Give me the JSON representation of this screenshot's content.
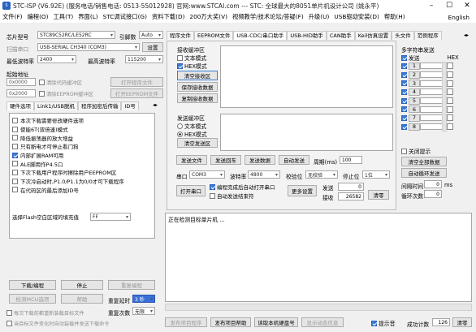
{
  "title": "STC-ISP (V6.92E) (服务电话/销售电话: 0513-55012928) 官网:www.STCAI.com  --- STC: 全球最大的8051单片机设计公司 (姚永平)",
  "menu": [
    "文件(F)",
    "编程(O)",
    "工具(T)",
    "界面(L)",
    "STC调试接口(G)",
    "资料下载(D)",
    "200万大奖(V)",
    "视频教学/技术论坛/答疑(F)",
    "升级(U)",
    "USB驱动安装(D)",
    "帮助(H)",
    "English"
  ],
  "left": {
    "chip_label": "芯片型号",
    "chip_value": "STC89C52RC/LE52RC",
    "engine_label": "引脚数",
    "engine_value": "Auto",
    "scan_label": "扫描串口",
    "port_value": "USB-SERIAL CH340 (COM3)",
    "settings_btn": "设置",
    "min_baud_label": "最低波特率",
    "min_baud": "2400",
    "max_baud_label": "最高波特率",
    "max_baud": "115200",
    "start_addr_label": "起始地址",
    "addr1": "0x0000",
    "clear_code": "清除代码缓冲区",
    "open_prog": "打开程序文件",
    "addr2": "0x2000",
    "clear_eeprom": "清除EEPROM缓冲区",
    "open_eeprom": "打开EEPROM文件",
    "hw_tab": "硬件选项",
    "tabs": [
      "Link1/USB脱机",
      "程序加密后传输",
      "ID号"
    ],
    "options": [
      {
        "label": "本次下载需要修改硬件选项",
        "on": false
      },
      {
        "label": "使能6T(双倍速)模式",
        "on": false
      },
      {
        "label": "降低振荡器的放大增益",
        "on": false
      },
      {
        "label": "只有断电才可停止看门狗",
        "on": false
      },
      {
        "label": "内部扩展RAM可用",
        "on": true
      },
      {
        "label": "ALE脚用作P4.5口",
        "on": false
      },
      {
        "label": "下次下载用户程序时擦除用户EEPROM区",
        "on": false
      },
      {
        "label": "下次冷启动时,P1.0/P1.1为0/0才可下载程序",
        "on": false
      },
      {
        "label": "在代码区的最后添加ID号",
        "on": false
      }
    ],
    "fill_label": "选择Flash空白区域的填充值",
    "fill_value": "FF",
    "download_btn": "下载/编程",
    "stop_btn": "停止",
    "reprogram_btn": "重复编程",
    "check_mcu_btn": "检测MCU选项",
    "help_btn": "帮助",
    "retry_delay_label": "重复延时",
    "retry_delay_value": "3 秒",
    "retry_count_label": "重复次数",
    "retry_count_value": "无限",
    "auto_load": "每次下载前都重新装载目标文件",
    "auto_send": "当目标文件变化时自动装载并发送下载命令"
  },
  "right": {
    "tabs": [
      "程序文件",
      "EEPROM文件",
      "USB-CDC/串口助手",
      "USB-HID助手",
      "CAN助手",
      "Keil仿真设置",
      "头文件",
      "范例程序"
    ],
    "recv_label": "接收缓冲区",
    "text_mode": "文本模式",
    "hex_mode": "HEX模式",
    "clear_recv": "清空接收区",
    "save_recv": "保存接收数据",
    "copy_recv": "复制接收数据",
    "send_label": "发送缓冲区",
    "clear_send": "清空发送区",
    "send_file": "发送文件",
    "send_enter": "发送回车",
    "send_data": "发送数据",
    "auto_send": "自动发送",
    "period_label": "周期(ms)",
    "period_value": "100",
    "port_label": "串口",
    "port_value": "COM3",
    "baud_label": "波特率",
    "baud_value": "4800",
    "parity_label": "校验位",
    "parity_value": "无校验",
    "stop_label": "停止位",
    "stop_value": "1位",
    "open_port": "打开串口",
    "auto_open": "编程完成后自动打开串口",
    "auto_end": "自动发送结束符",
    "more": "更多设置",
    "sent_label": "发送",
    "sent_value": "0",
    "recv_count_label": "接收",
    "recv_count_value": "26582",
    "clear_btn": "清零",
    "multi_label": "多字符串发送",
    "send_col": "发送",
    "hex_col": "HEX",
    "multi_rows": [
      "1",
      "2",
      "3",
      "4",
      "5",
      "6",
      "7",
      "8"
    ],
    "close_tip": "关闭提示",
    "clear_all": "清空全部数据",
    "auto_loop": "自动循环发送",
    "interval_label": "间隔时间",
    "interval_value": "0",
    "interval_unit": "ms",
    "loop_label": "循环次数",
    "loop_value": "0",
    "log_text": "正在检测目标单片机 ..."
  },
  "status": {
    "publish_prog": "发布项目程序",
    "publish_help": "发布项目帮助",
    "read_id": "读取本机硬盘号",
    "show_info": "显示动态信息",
    "tip_sound": "提示音",
    "success_label": "成功计数",
    "success_value": "126",
    "clear": "清零"
  }
}
